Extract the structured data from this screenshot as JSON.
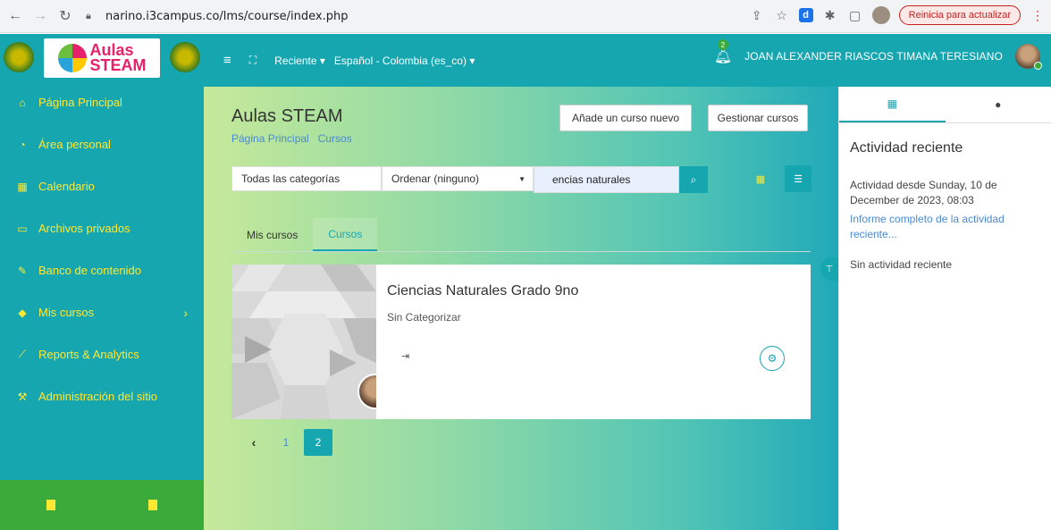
{
  "browser": {
    "url": "narino.i3campus.co/lms/course/index.php",
    "update_button": "Reinicia para actualizar"
  },
  "logo": {
    "line1": "Aulas",
    "line2": "STEAM"
  },
  "sidebar": {
    "items": [
      {
        "label": "Página Principal",
        "icon": "home-icon"
      },
      {
        "label": "Área personal",
        "icon": "dashboard-icon"
      },
      {
        "label": "Calendario",
        "icon": "calendar-icon"
      },
      {
        "label": "Archivos privados",
        "icon": "file-icon"
      },
      {
        "label": "Banco de contenido",
        "icon": "paint-brush-icon"
      },
      {
        "label": "Mis cursos",
        "icon": "graduation-cap-icon"
      },
      {
        "label": "Reports & Analytics",
        "icon": "chart-icon"
      },
      {
        "label": "Administración del sitio",
        "icon": "wrench-icon"
      }
    ]
  },
  "topnav": {
    "recent": "Reciente",
    "language": "Español - Colombia (es_co)",
    "notification_count": "2",
    "user_name": "JOAN ALEXANDER RIASCOS TIMANA TERESIANO"
  },
  "main": {
    "title": "Aulas STEAM",
    "breadcrumb": [
      "Página Principal",
      "Cursos"
    ],
    "add_course_button": "Añade un curso nuevo",
    "manage_courses_button": "Gestionar cursos",
    "category_filter": "Todas las categorías",
    "sort_filter": "Ordenar (ninguno)",
    "search_value": "encias naturales",
    "tabs": [
      "Mis cursos",
      "Cursos"
    ],
    "course": {
      "title": "Ciencias Naturales Grado 9no",
      "category": "Sin Categorizar"
    },
    "pagination": [
      "1",
      "2"
    ]
  },
  "drawer": {
    "heading": "Actividad reciente",
    "since": "Actividad desde Sunday, 10 de December de 2023, 08:03",
    "report_link": "Informe completo de la actividad reciente...",
    "no_activity": "Sin actividad reciente"
  },
  "colors": {
    "primary": "#16a6b0",
    "sidebar_text": "#ffe833",
    "footer_green": "#3aab3a",
    "link": "#4a8ad0"
  }
}
